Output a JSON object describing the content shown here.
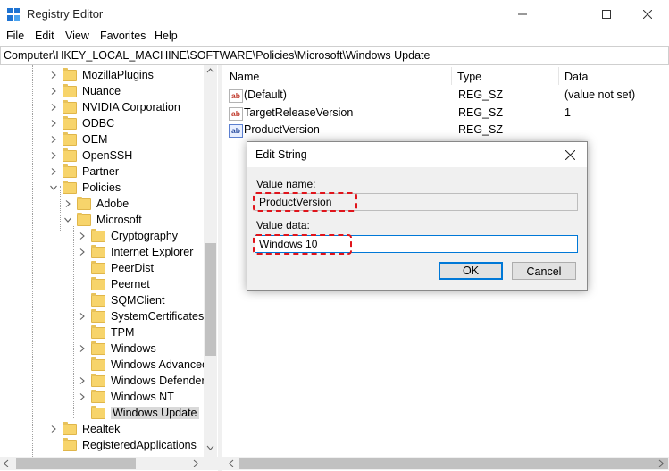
{
  "window": {
    "title": "Registry Editor"
  },
  "menu": [
    "File",
    "Edit",
    "View",
    "Favorites",
    "Help"
  ],
  "address": "Computer\\HKEY_LOCAL_MACHINE\\SOFTWARE\\Policies\\Microsoft\\Windows Update",
  "tree": {
    "items": [
      {
        "label": "MozillaPlugins",
        "level": 0,
        "expand": "collapsed"
      },
      {
        "label": "Nuance",
        "level": 0,
        "expand": "collapsed"
      },
      {
        "label": "NVIDIA Corporation",
        "level": 0,
        "expand": "collapsed"
      },
      {
        "label": "ODBC",
        "level": 0,
        "expand": "collapsed"
      },
      {
        "label": "OEM",
        "level": 0,
        "expand": "collapsed"
      },
      {
        "label": "OpenSSH",
        "level": 0,
        "expand": "collapsed"
      },
      {
        "label": "Partner",
        "level": 0,
        "expand": "collapsed"
      },
      {
        "label": "Policies",
        "level": 0,
        "expand": "expanded"
      },
      {
        "label": "Adobe",
        "level": 1,
        "expand": "collapsed"
      },
      {
        "label": "Microsoft",
        "level": 1,
        "expand": "expanded"
      },
      {
        "label": "Cryptography",
        "level": 2,
        "expand": "collapsed"
      },
      {
        "label": "Internet Explorer",
        "level": 2,
        "expand": "collapsed"
      },
      {
        "label": "PeerDist",
        "level": 2,
        "expand": "none"
      },
      {
        "label": "Peernet",
        "level": 2,
        "expand": "none"
      },
      {
        "label": "SQMClient",
        "level": 2,
        "expand": "none"
      },
      {
        "label": "SystemCertificates",
        "level": 2,
        "expand": "collapsed"
      },
      {
        "label": "TPM",
        "level": 2,
        "expand": "none"
      },
      {
        "label": "Windows",
        "level": 2,
        "expand": "collapsed"
      },
      {
        "label": "Windows Advanced",
        "level": 2,
        "expand": "none"
      },
      {
        "label": "Windows Defender",
        "level": 2,
        "expand": "collapsed"
      },
      {
        "label": "Windows NT",
        "level": 2,
        "expand": "collapsed"
      },
      {
        "label": "Windows Update",
        "level": 2,
        "expand": "none",
        "selected": true
      },
      {
        "label": "Realtek",
        "level": 0,
        "expand": "collapsed"
      },
      {
        "label": "RegisteredApplications",
        "level": 0,
        "expand": "none"
      }
    ]
  },
  "list": {
    "columns": [
      "Name",
      "Type",
      "Data"
    ],
    "rows": [
      {
        "name": "(Default)",
        "type": "REG_SZ",
        "data": "(value not set)",
        "icon": "string-value-icon"
      },
      {
        "name": "TargetReleaseVersion",
        "type": "REG_SZ",
        "data": "1",
        "icon": "string-value-icon"
      },
      {
        "name": "ProductVersion",
        "type": "REG_SZ",
        "data": "",
        "icon": "string-value-icon",
        "selected": true
      }
    ]
  },
  "dialog": {
    "title": "Edit String",
    "value_name_label": "Value name:",
    "value_name": "ProductVersion",
    "value_data_label": "Value data:",
    "value_data": "Windows 10",
    "ok_label": "OK",
    "cancel_label": "Cancel"
  },
  "colors": {
    "highlight": "#e0141b",
    "focus": "#0078d7",
    "folder": "#f7d46b"
  }
}
